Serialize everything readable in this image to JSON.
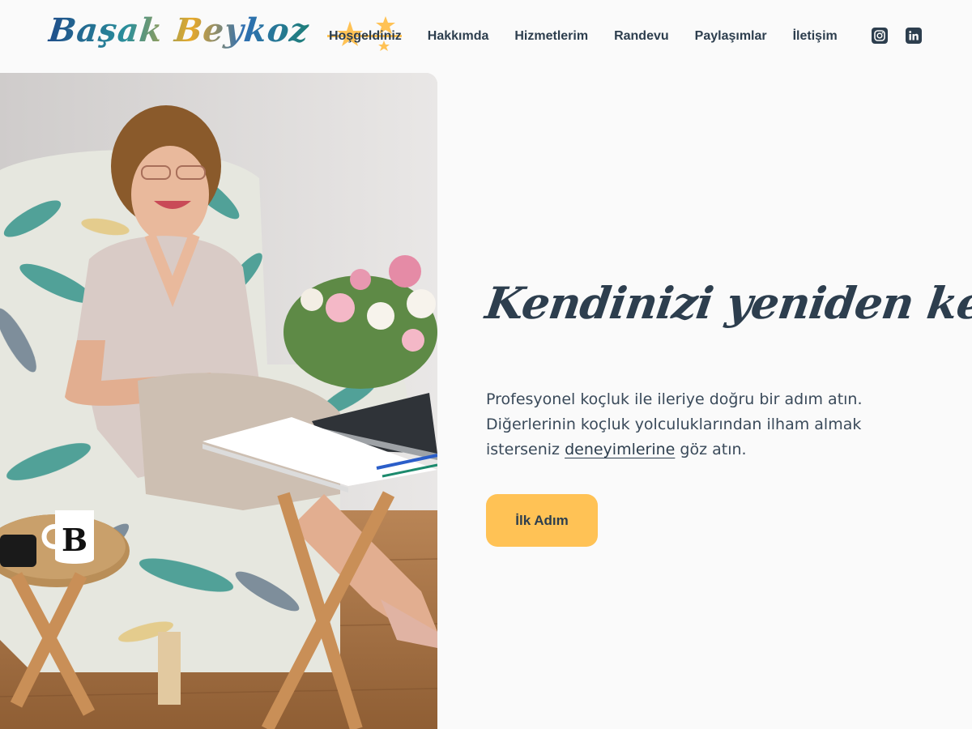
{
  "brand": {
    "logo_text": "Başak Beykoz"
  },
  "nav": {
    "items": [
      {
        "label": "Hoşgeldiniz",
        "active": true
      },
      {
        "label": "Hakkımda"
      },
      {
        "label": "Hizmetlerim"
      },
      {
        "label": "Randevu"
      },
      {
        "label": "Paylaşımlar"
      },
      {
        "label": "İletişim"
      }
    ],
    "social": [
      {
        "icon": "instagram-icon"
      },
      {
        "icon": "linkedin-icon"
      }
    ]
  },
  "hero": {
    "headline": "Kendinizi yeniden keşfedin",
    "lead_part1": "Profesyonel koçluk ile ileriye doğru bir adım atın. Diğerlerinin koçluk yolculuklarından ilham almak isterseniz ",
    "lead_link": "deneyimlerine",
    "lead_part2": " göz atın.",
    "cta_label": "İlk Adım",
    "mug_letter": "B"
  },
  "colors": {
    "text": "#2d3e4e",
    "accent": "#ffc255",
    "background": "#fafafa"
  }
}
